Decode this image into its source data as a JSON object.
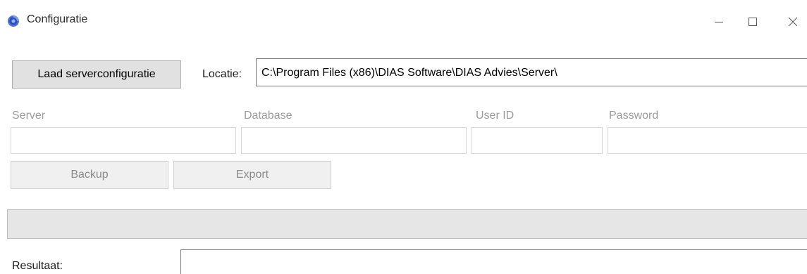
{
  "window": {
    "title": "Configuratie",
    "icon": "app-logo-icon",
    "controls": [
      "minimize-icon",
      "maximize-icon",
      "close-icon"
    ]
  },
  "toolbar": {
    "load_button_label": "Laad serverconfiguratie",
    "location_label": "Locatie:",
    "location_value": "C:\\Program Files (x86)\\DIAS Software\\DIAS Advies\\Server\\"
  },
  "fields": {
    "server_label": "Server",
    "server_value": "",
    "database_label": "Database",
    "database_value": "",
    "userid_label": "User ID",
    "userid_value": "",
    "password_label": "Password",
    "password_value": ""
  },
  "actions": {
    "backup_label": "Backup",
    "export_label": "Export"
  },
  "progress": {
    "value_percent": 0
  },
  "result": {
    "label": "Resultaat:",
    "value": ""
  },
  "colors": {
    "accent_icon": "#3a5fcd",
    "disabled_text": "#9b9b9b",
    "button_bg": "#e1e1e1",
    "progress_track": "#e6e6e6"
  }
}
